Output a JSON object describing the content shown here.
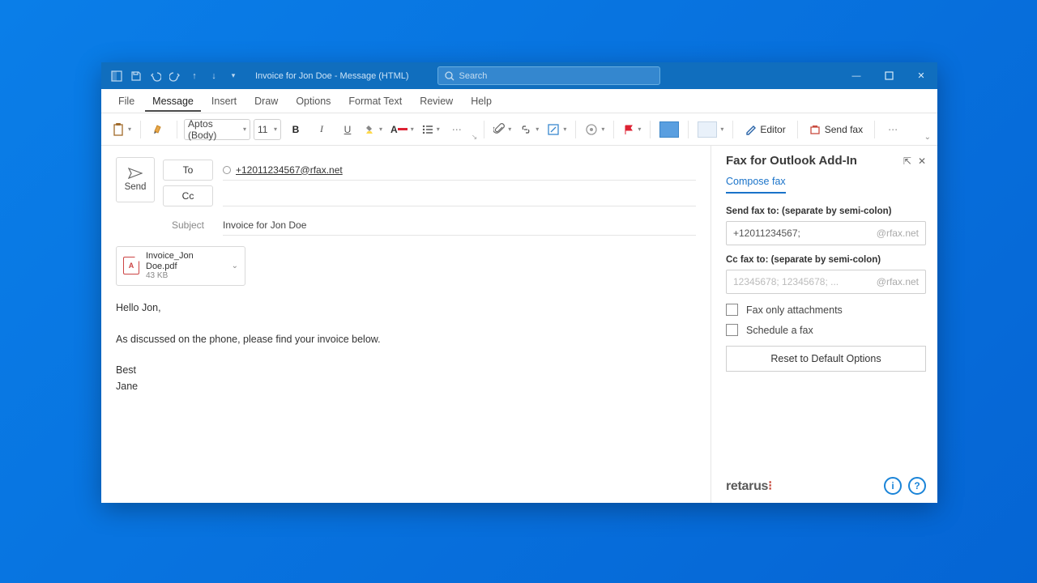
{
  "titlebar": {
    "title": "Invoice for Jon Doe  -  Message (HTML)",
    "search_placeholder": "Search"
  },
  "menu": {
    "tabs": [
      "File",
      "Message",
      "Insert",
      "Draw",
      "Options",
      "Format Text",
      "Review",
      "Help"
    ],
    "active": "Message"
  },
  "ribbon": {
    "font": "Aptos (Body)",
    "size": "11",
    "editor_label": "Editor",
    "sendfax_label": "Send fax"
  },
  "compose": {
    "send_label": "Send",
    "to_label": "To",
    "cc_label": "Cc",
    "subject_label": "Subject",
    "to_value": "+12011234567@rfax.net",
    "cc_value": "",
    "subject_value": "Invoice for Jon Doe",
    "attachment": {
      "name": "Invoice_Jon Doe.pdf",
      "size": "43 KB"
    },
    "body_lines": [
      "Hello Jon,",
      "",
      "As discussed on the phone, please find your invoice below.",
      "",
      "Best",
      "Jane"
    ]
  },
  "panel": {
    "title": "Fax for Outlook Add-In",
    "tab": "Compose fax",
    "sendto_label": "Send fax to: (separate by semi-colon)",
    "sendto_value": "+12011234567;",
    "ccto_label": "Cc fax to: (separate by semi-colon)",
    "ccto_placeholder": "12345678; 12345678; ...",
    "domain_suffix": "@rfax.net",
    "chk_attachments": "Fax only attachments",
    "chk_schedule": "Schedule a fax",
    "reset_button": "Reset to Default Options",
    "brand": "retarus"
  }
}
